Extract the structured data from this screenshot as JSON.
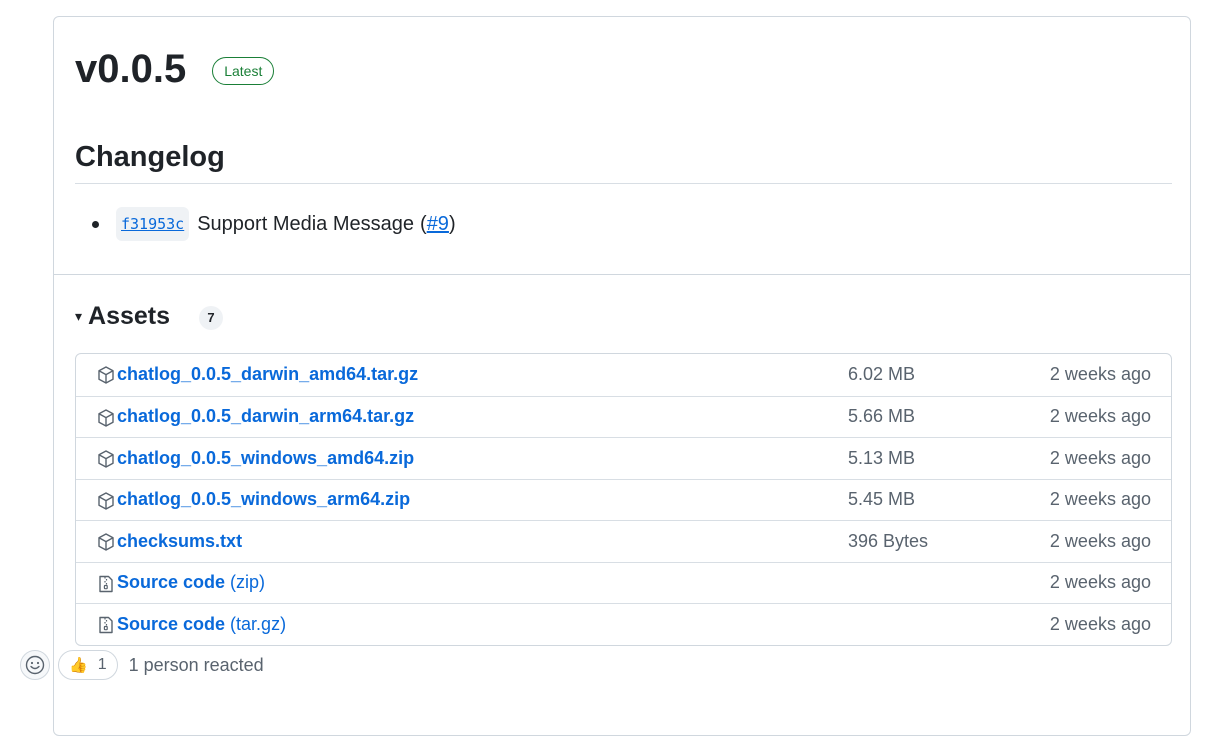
{
  "release": {
    "version": "v0.0.5",
    "badge": "Latest"
  },
  "changelog": {
    "title": "Changelog",
    "items": [
      {
        "sha": "f31953c",
        "message": "Support Media Message",
        "paren_open": "(",
        "issue": "#9",
        "paren_close": ")"
      }
    ]
  },
  "assets": {
    "caret": "▾",
    "title": "Assets",
    "count": "7",
    "items": [
      {
        "icon": "package-icon",
        "name": "chatlog_0.0.5_darwin_amd64.tar.gz",
        "suffix": "",
        "size": "6.02 MB",
        "time": "2 weeks ago"
      },
      {
        "icon": "package-icon",
        "name": "chatlog_0.0.5_darwin_arm64.tar.gz",
        "suffix": "",
        "size": "5.66 MB",
        "time": "2 weeks ago"
      },
      {
        "icon": "package-icon",
        "name": "chatlog_0.0.5_windows_amd64.zip",
        "suffix": "",
        "size": "5.13 MB",
        "time": "2 weeks ago"
      },
      {
        "icon": "package-icon",
        "name": "chatlog_0.0.5_windows_arm64.zip",
        "suffix": "",
        "size": "5.45 MB",
        "time": "2 weeks ago"
      },
      {
        "icon": "package-icon",
        "name": "checksums.txt",
        "suffix": "",
        "size": "396 Bytes",
        "time": "2 weeks ago"
      },
      {
        "icon": "file-zip-icon",
        "name": "Source code",
        "suffix": " (zip)",
        "size": "",
        "time": "2 weeks ago"
      },
      {
        "icon": "file-zip-icon",
        "name": "Source code",
        "suffix": " (tar.gz)",
        "size": "",
        "time": "2 weeks ago"
      }
    ]
  },
  "reactions": {
    "picker_icon": "smiley-icon",
    "thumbs_up": "👍",
    "thumbs_up_count": "1",
    "summary": "1 person reacted"
  },
  "colors": {
    "link": "#0969da",
    "latest_badge": "#1a7f37",
    "muted_text": "#59636e",
    "border": "#d0d7de"
  }
}
